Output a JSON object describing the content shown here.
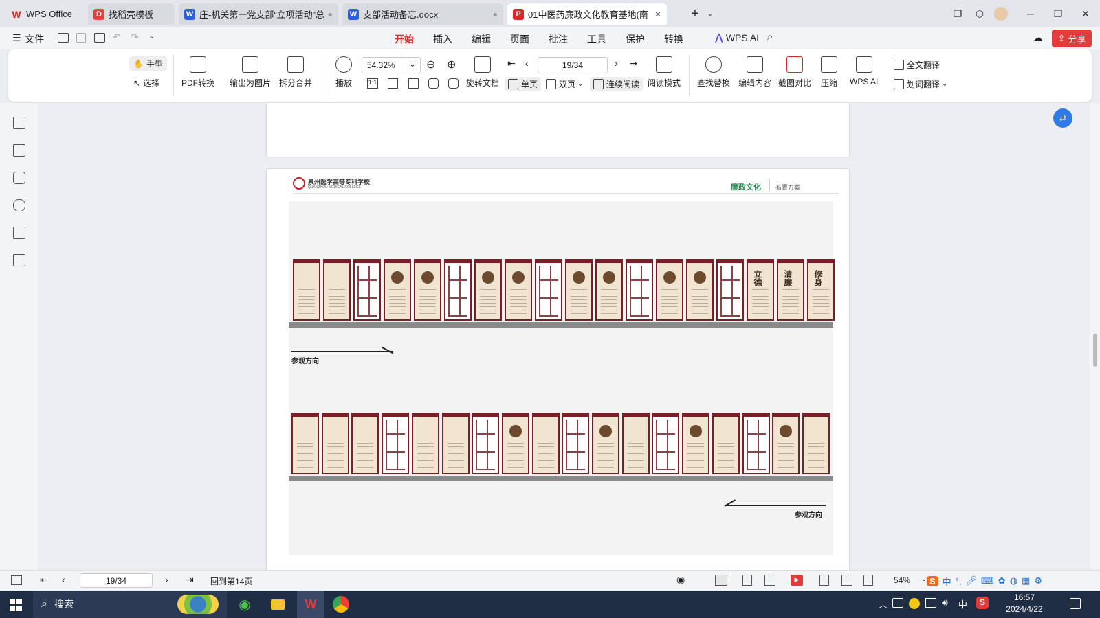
{
  "tabs": [
    {
      "label": "WPS Office",
      "icon": "wps-logo-icon",
      "color": "#d42a2a"
    },
    {
      "label": "找稻壳模板",
      "icon": "docer-icon",
      "color": "#e0413f"
    },
    {
      "label": "庄-机关第一党支部“立项活动”总",
      "icon": "word-doc-icon",
      "color": "#2f5fd8"
    },
    {
      "label": "支部活动备忘.docx",
      "icon": "word-doc-icon",
      "color": "#2f5fd8"
    },
    {
      "label": "01中医药廉政文化教育基地(南",
      "icon": "pdf-icon",
      "color": "#d42a2a"
    }
  ],
  "menu": {
    "file": "文件",
    "items": [
      "开始",
      "插入",
      "编辑",
      "页面",
      "批注",
      "工具",
      "保护",
      "转换"
    ],
    "active": "开始",
    "wps_ai": "WPS AI",
    "share": "分享"
  },
  "ribbon": {
    "hand": "手型",
    "select": "选择",
    "pdf_convert": "PDF转换",
    "export_image": "输出为图片",
    "split_merge": "拆分合并",
    "play": "播放",
    "zoom": "54.32%",
    "page_input": "19/34",
    "rotate": "旋转文档",
    "single": "单页",
    "double": "双页",
    "continuous": "连续阅读",
    "read_mode": "阅读模式",
    "find_replace": "查找替换",
    "edit_content": "编辑内容",
    "screenshot_compare": "截图对比",
    "compress": "压缩",
    "wps_ai": "WPS AI",
    "translate_full": "全文翻译",
    "translate_word": "划词翻译"
  },
  "document": {
    "school_name": "泉州医学高等专科学校",
    "school_en": "QUANZHOU MEDICAL COLLEGE",
    "header_green": "廉政文化",
    "header_gray": "布置方案",
    "direction1": "参观方向",
    "direction2": "参观方向",
    "panel_chars": [
      "立德",
      "清廉",
      "修身"
    ]
  },
  "status": {
    "page_input": "19/34",
    "back_to": "回到第14页",
    "zoom": "54%"
  },
  "taskbar": {
    "search": "搜索",
    "time": "16:57",
    "date": "2024/4/22",
    "ime": "中",
    "ime2": "中"
  }
}
